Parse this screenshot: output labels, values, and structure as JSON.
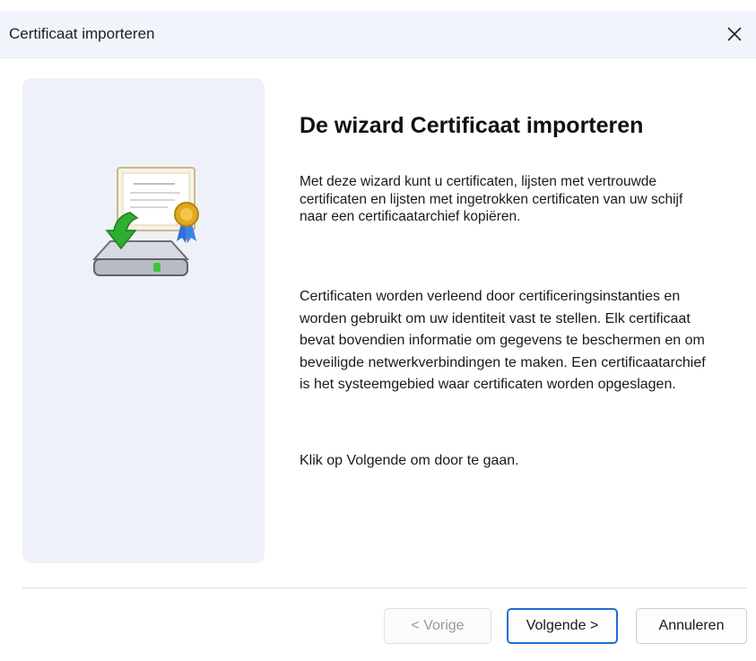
{
  "window": {
    "title": "Certificaat importeren",
    "close_icon": "close-icon"
  },
  "sidebar": {
    "illustration_icon": "certificate-import-icon"
  },
  "main": {
    "heading": "De wizard Certificaat importeren",
    "paragraph1": "Met deze wizard kunt u certificaten, lijsten met vertrouwde certificaten en lijsten met ingetrokken certificaten van uw schijf naar een certificaatarchief kopiëren.",
    "paragraph2": "Certificaten worden verleend door certificeringsinstanties en worden gebruikt om uw identiteit vast te stellen. Elk certificaat bevat bovendien informatie om gegevens te beschermen en om beveiligde netwerkverbindingen te maken. Een certificaatarchief is het systeemgebied waar certificaten worden opgeslagen.",
    "paragraph3": "Klik op Volgende om door te gaan."
  },
  "buttons": {
    "prev_label": "< Vorige",
    "prev_disabled": true,
    "next_label": "Volgende >",
    "cancel_label": "Annuleren"
  },
  "colors": {
    "accent": "#1f6fd1",
    "titlebar_bg": "#f1f5fb",
    "panel_bg": "#eef2f8"
  }
}
